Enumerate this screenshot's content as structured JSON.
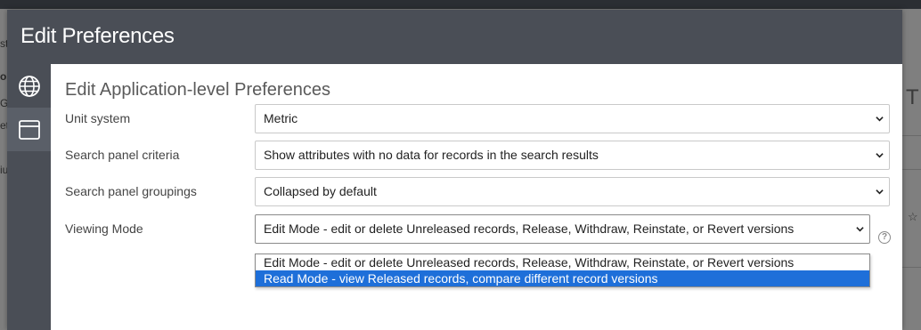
{
  "background": {
    "fragments": [
      "st",
      "or",
      "G",
      "et",
      "iu"
    ],
    "right_title": "T",
    "right_icon": "star-icon"
  },
  "modal": {
    "title": "Edit Preferences",
    "sidebar": [
      {
        "icon": "globe-icon",
        "active": false
      },
      {
        "icon": "window-icon",
        "active": true
      }
    ],
    "section_title": "Edit Application-level Preferences",
    "rows": [
      {
        "label": "Unit system",
        "value": "Metric"
      },
      {
        "label": "Search panel criteria",
        "value": "Show attributes with no data for records in the search results"
      },
      {
        "label": "Search panel groupings",
        "value": "Collapsed by default"
      },
      {
        "label": "Viewing Mode",
        "value": "Edit Mode - edit or delete Unreleased records, Release, Withdraw, Reinstate, or Revert versions"
      }
    ],
    "help_icon_label": "?",
    "dropdown_options": [
      "Edit Mode - edit or delete Unreleased records, Release, Withdraw, Reinstate, or Revert versions",
      "Read Mode - view Released records, compare different record versions"
    ],
    "dropdown_highlighted_index": 1
  },
  "colors": {
    "header_bg": "#4a4e56",
    "highlight": "#1e6fd9"
  }
}
